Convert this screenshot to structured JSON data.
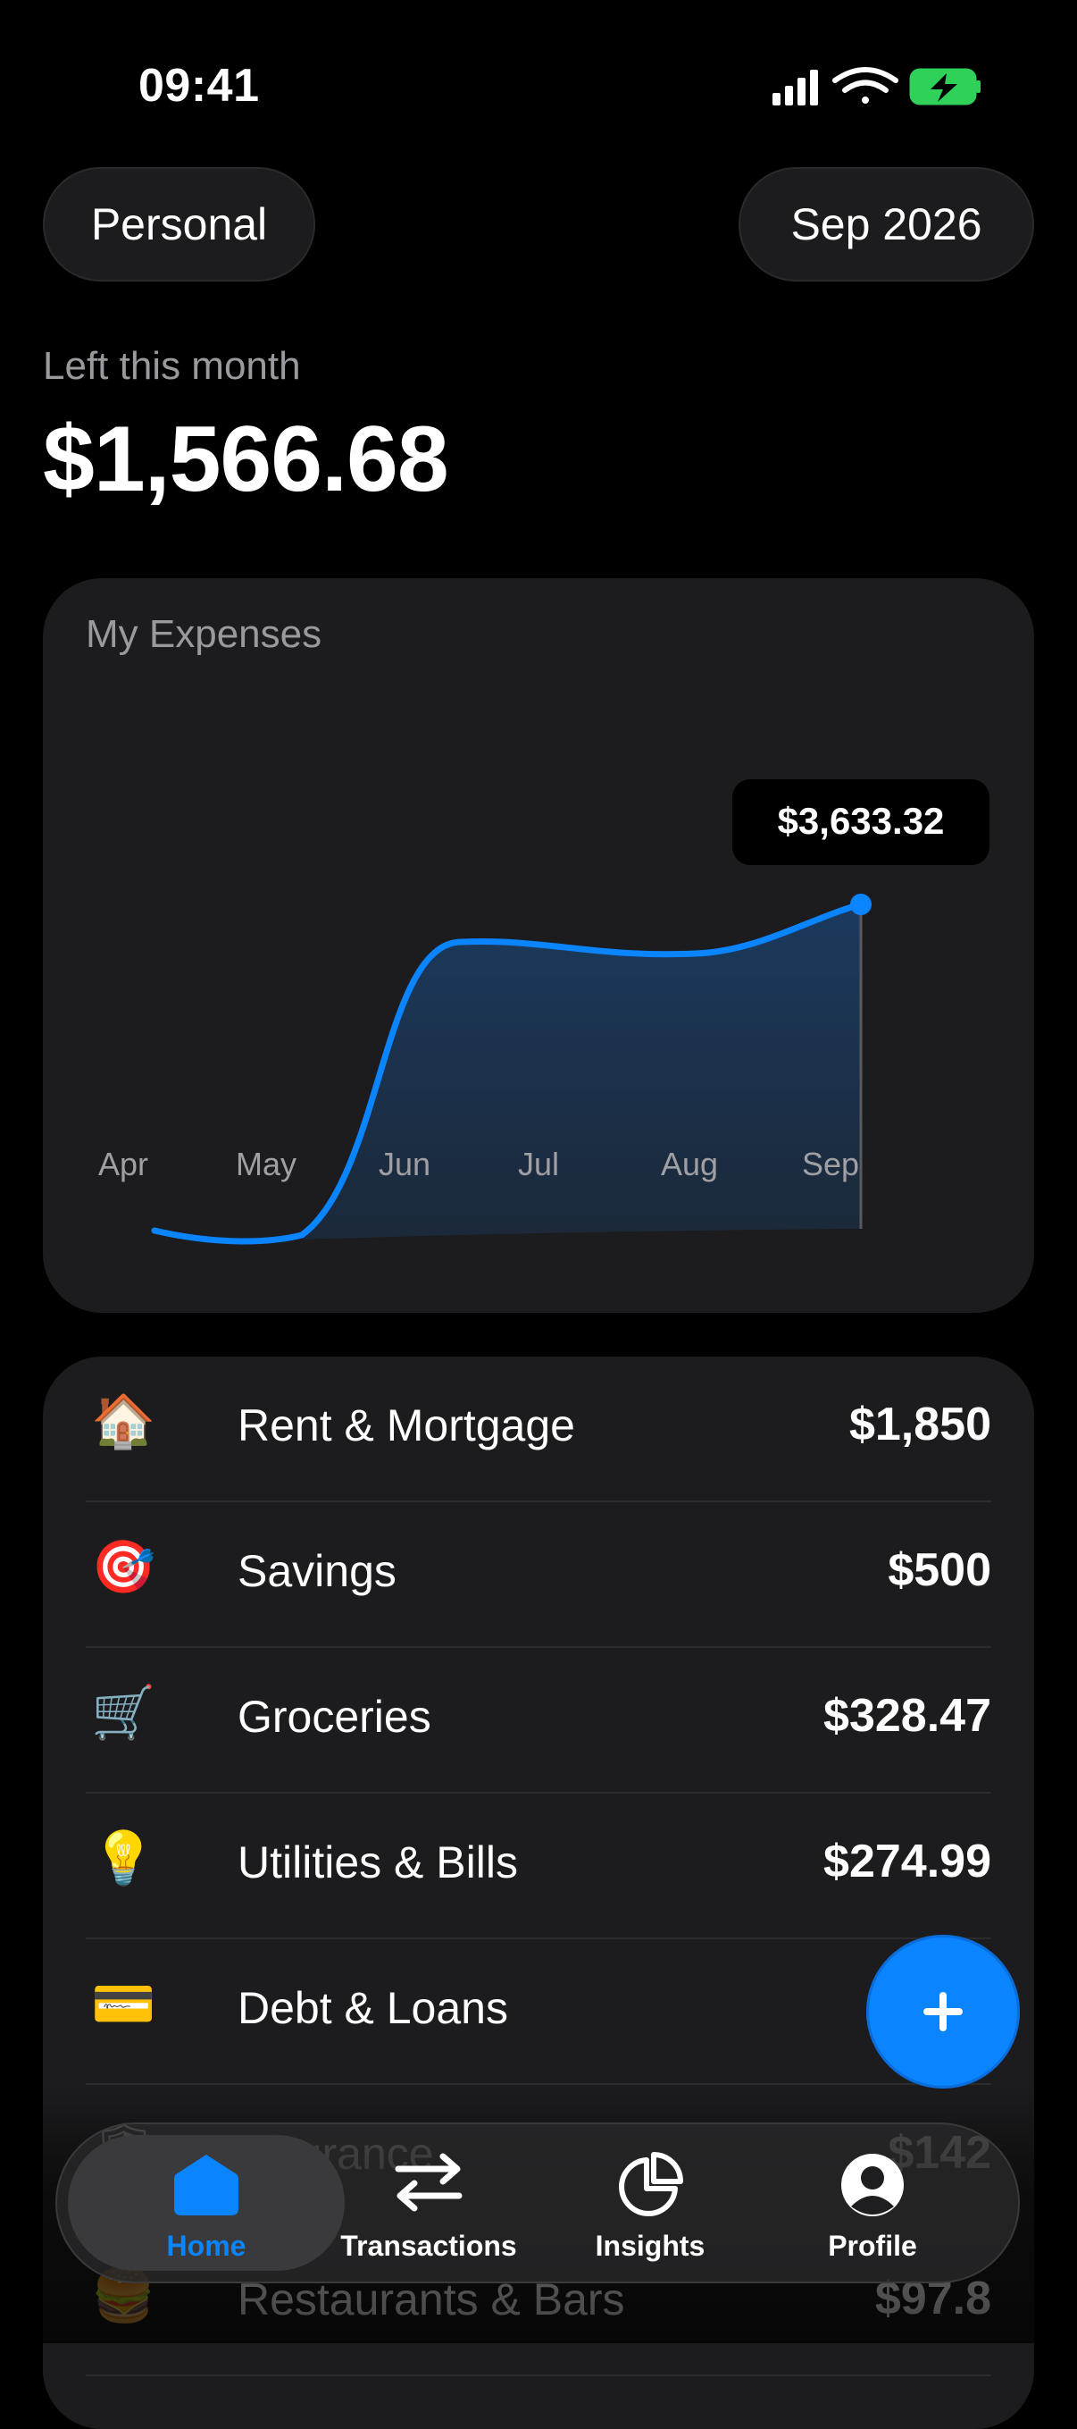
{
  "status_bar": {
    "time": "09:41"
  },
  "header": {
    "account_label": "Personal",
    "period_label": "Sep 2026"
  },
  "summary": {
    "label": "Left this month",
    "amount": "$1,566.68"
  },
  "chart": {
    "title": "My Expenses",
    "tooltip_value": "$3,633.32",
    "colors": {
      "line": "#0a84ff",
      "fill_top": "#1a3a5c"
    }
  },
  "chart_data": {
    "type": "area",
    "title": "My Expenses",
    "categories": [
      "Apr",
      "May",
      "Jun",
      "Jul",
      "Aug",
      "Sep"
    ],
    "highlight": {
      "category": "Sep",
      "value": "$3,633.32"
    },
    "grid": false
  },
  "categories": [
    {
      "icon": "house-icon",
      "emoji": "🏠",
      "name": "Rent & Mortgage",
      "amount": "$1,850"
    },
    {
      "icon": "target-icon",
      "emoji": "🎯",
      "name": "Savings",
      "amount": "$500"
    },
    {
      "icon": "cart-icon",
      "emoji": "🛒",
      "name": "Groceries",
      "amount": "$328.47"
    },
    {
      "icon": "lightbulb-icon",
      "emoji": "💡",
      "name": "Utilities & Bills",
      "amount": "$274.99"
    },
    {
      "icon": "credit-card-icon",
      "emoji": "💳",
      "name": "Debt & Loans",
      "amount": "$"
    },
    {
      "icon": "shield-icon",
      "emoji": "🛡",
      "name": "Insurance",
      "amount": "$142"
    },
    {
      "icon": "burger-icon",
      "emoji": "🍔",
      "name": "Restaurants & Bars",
      "amount": "$97.8"
    }
  ],
  "tabs": [
    {
      "label": "Home",
      "active": true
    },
    {
      "label": "Transactions",
      "active": false
    },
    {
      "label": "Insights",
      "active": false
    },
    {
      "label": "Profile",
      "active": false
    }
  ],
  "fab": {
    "icon": "plus-icon"
  },
  "accent_color": "#0a84ff"
}
